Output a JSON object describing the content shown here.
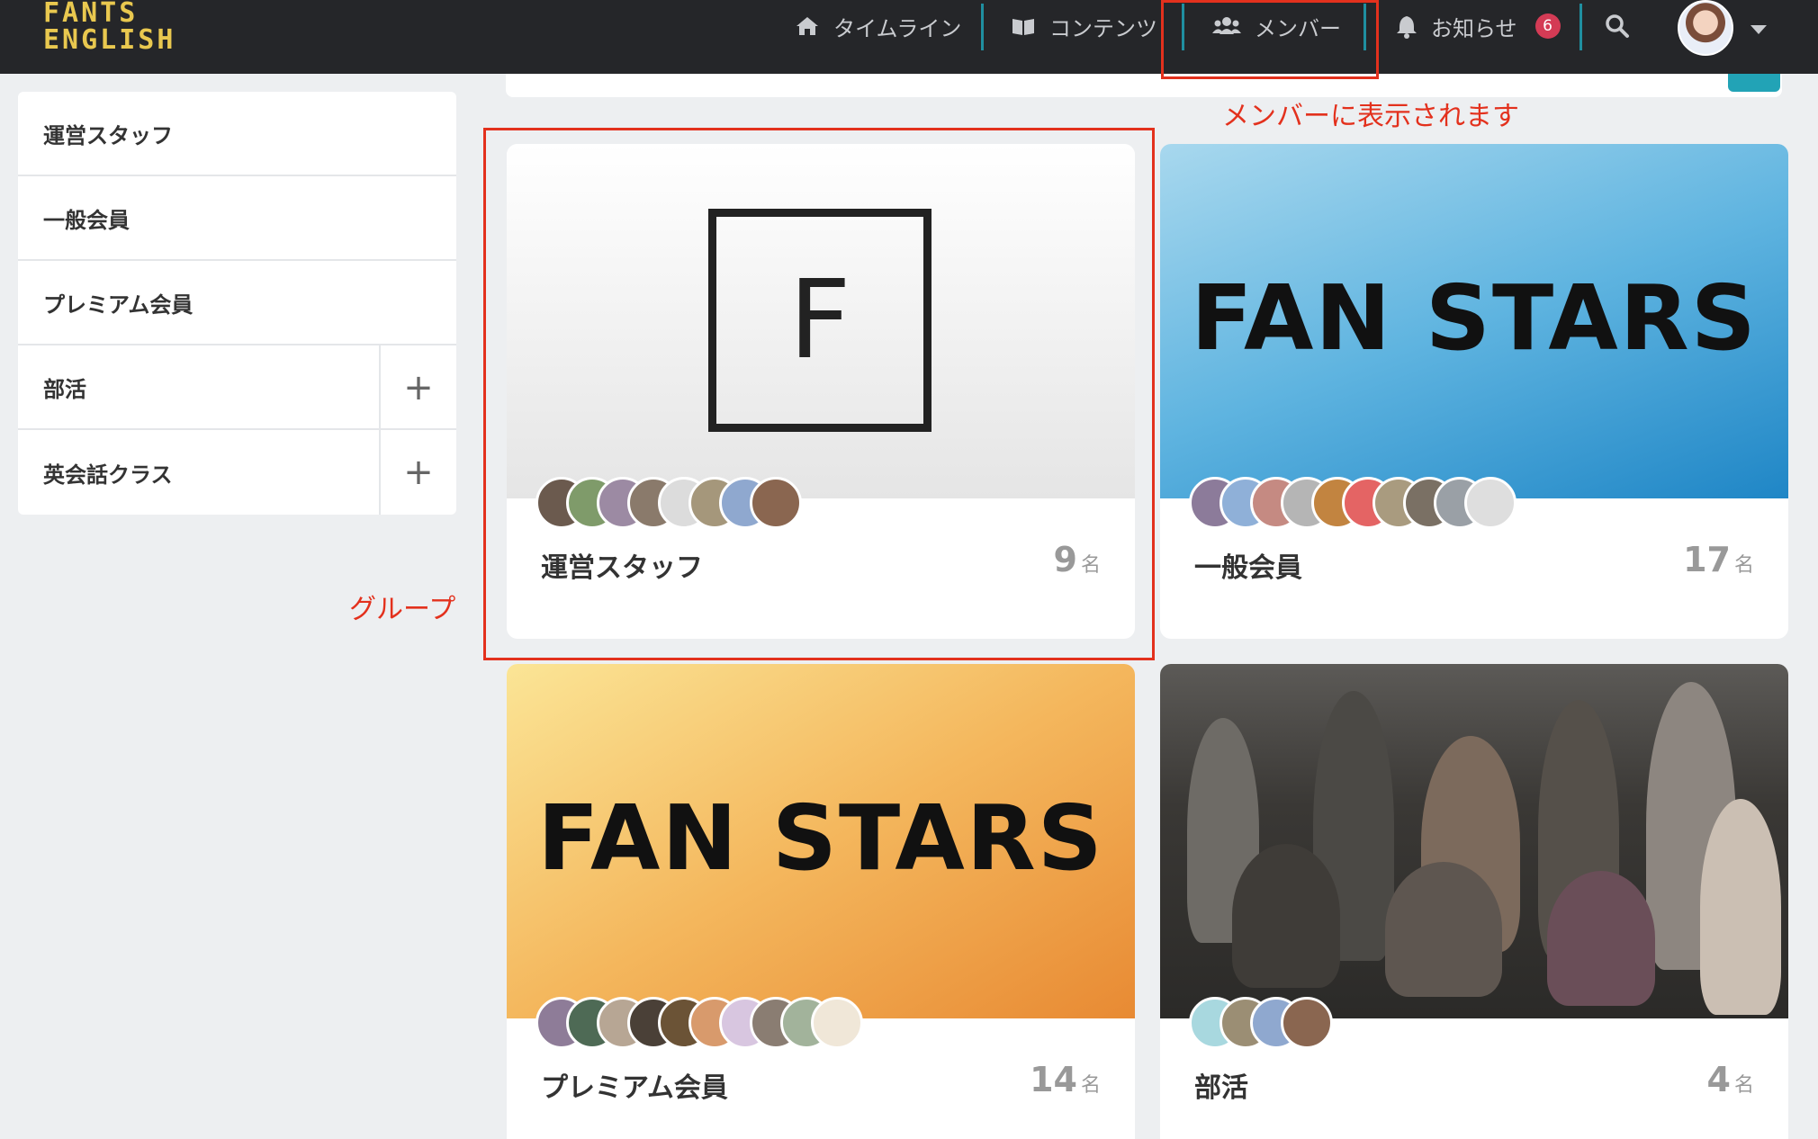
{
  "header": {
    "logo_line1": "FANTS",
    "logo_line2": "ENGLISH",
    "nav": [
      {
        "label": "タイムライン",
        "icon": "home-icon"
      },
      {
        "label": "コンテンツ",
        "icon": "book-icon"
      },
      {
        "label": "メンバー",
        "icon": "users-icon"
      },
      {
        "label": "お知らせ",
        "icon": "bell-icon",
        "badge": "6"
      }
    ],
    "search_icon": "search-icon"
  },
  "annotations": {
    "members_note": "メンバーに表示されます",
    "group_note": "グループ",
    "color": "#e3311d"
  },
  "sidebar": {
    "items": [
      {
        "label": "運営スタッフ"
      },
      {
        "label": "一般会員"
      },
      {
        "label": "プレミアム会員"
      },
      {
        "label": "部活",
        "expand": "+"
      },
      {
        "label": "英会話クラス",
        "expand": "+"
      }
    ]
  },
  "cards": [
    {
      "name": "運営スタッフ",
      "count": "9",
      "unit": "名",
      "image_text": "F"
    },
    {
      "name": "一般会員",
      "count": "17",
      "unit": "名",
      "image_text": "FAN STARS"
    },
    {
      "name": "プレミアム会員",
      "count": "14",
      "unit": "名",
      "image_text": "FAN STARS"
    },
    {
      "name": "部活",
      "count": "4",
      "unit": "名"
    }
  ],
  "colors": {
    "header_bg": "#252629",
    "logo": "#e9c84f",
    "accent": "#1f8fa0",
    "badge": "#d43b55"
  }
}
